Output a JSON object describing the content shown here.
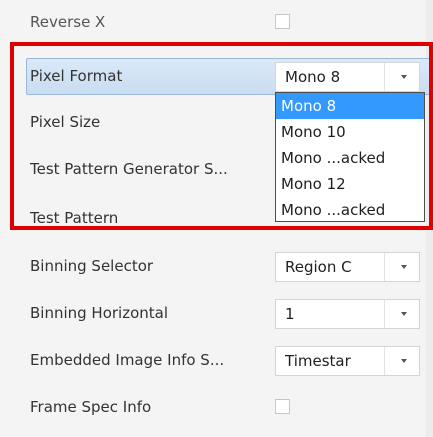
{
  "rows": [
    {
      "label": "Reverse X",
      "type": "checkbox"
    },
    {
      "label": "Pixel Format",
      "type": "combo",
      "value": "Mono 8"
    },
    {
      "label": "Pixel Size",
      "type": "text"
    },
    {
      "label": "Test Pattern Generator S...",
      "type": "text"
    },
    {
      "label": "Test Pattern",
      "type": "text"
    },
    {
      "label": "Binning Selector",
      "type": "combo",
      "value": "Region C"
    },
    {
      "label": "Binning Horizontal",
      "type": "combo",
      "value": "1"
    },
    {
      "label": "Embedded Image Info S...",
      "type": "combo",
      "value": "Timestar"
    },
    {
      "label": "Frame Spec Info",
      "type": "checkbox"
    }
  ],
  "pixel_format_dropdown": {
    "options": [
      "Mono 8",
      "Mono 10",
      "Mono ...acked",
      "Mono 12",
      "Mono ...acked"
    ],
    "selected": "Mono 8"
  },
  "colors": {
    "highlight_border": "#e00000",
    "selected_option": "#3399ff",
    "selected_row": "#c9dcf2"
  },
  "icons": {
    "dropdown_arrow": "chevron-down-icon"
  }
}
